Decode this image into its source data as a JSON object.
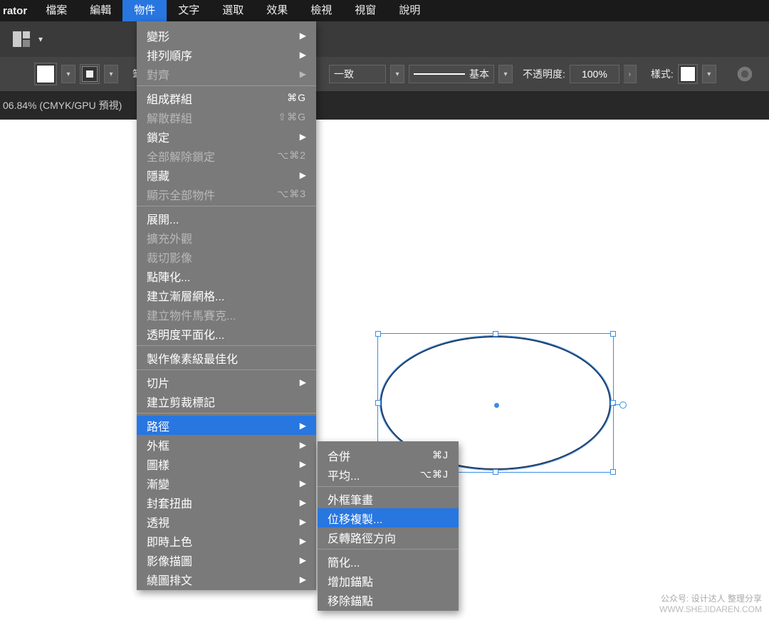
{
  "menubar": {
    "app": "rator",
    "items": [
      "檔案",
      "編輯",
      "物件",
      "文字",
      "選取",
      "效果",
      "檢視",
      "視窗",
      "說明"
    ],
    "active_index": 2
  },
  "options_bar": {
    "stroke_uniform": "一致",
    "stroke_style": "基本",
    "opacity_label": "不透明度:",
    "opacity_value": "100%",
    "style_label": "樣式:",
    "brush_hint": "筆"
  },
  "document": {
    "tab_label": "06.84% (CMYK/GPU 預視)"
  },
  "menu_object": {
    "groups": [
      [
        {
          "label": "變形",
          "arrow": true
        },
        {
          "label": "排列順序",
          "arrow": true
        },
        {
          "label": "對齊",
          "arrow": true,
          "disabled": true
        }
      ],
      [
        {
          "label": "組成群組",
          "shortcut": "⌘G"
        },
        {
          "label": "解散群組",
          "shortcut": "⇧⌘G",
          "disabled": true
        },
        {
          "label": "鎖定",
          "arrow": true
        },
        {
          "label": "全部解除鎖定",
          "shortcut": "⌥⌘2",
          "disabled": true
        },
        {
          "label": "隱藏",
          "arrow": true
        },
        {
          "label": "顯示全部物件",
          "shortcut": "⌥⌘3",
          "disabled": true
        }
      ],
      [
        {
          "label": "展開..."
        },
        {
          "label": "擴充外觀",
          "disabled": true
        },
        {
          "label": "裁切影像",
          "disabled": true
        },
        {
          "label": "點陣化..."
        },
        {
          "label": "建立漸層網格..."
        },
        {
          "label": "建立物件馬賽克...",
          "disabled": true
        },
        {
          "label": "透明度平面化..."
        }
      ],
      [
        {
          "label": "製作像素級最佳化"
        }
      ],
      [
        {
          "label": "切片",
          "arrow": true
        },
        {
          "label": "建立剪裁標記"
        }
      ],
      [
        {
          "label": "路徑",
          "arrow": true,
          "hl": true
        },
        {
          "label": "外框",
          "arrow": true
        },
        {
          "label": "圖樣",
          "arrow": true
        },
        {
          "label": "漸變",
          "arrow": true
        },
        {
          "label": "封套扭曲",
          "arrow": true
        },
        {
          "label": "透視",
          "arrow": true
        },
        {
          "label": "即時上色",
          "arrow": true
        },
        {
          "label": "影像描圖",
          "arrow": true
        },
        {
          "label": "繞圖排文",
          "arrow": true
        }
      ]
    ]
  },
  "submenu_path": {
    "groups": [
      [
        {
          "label": "合併",
          "shortcut": "⌘J"
        },
        {
          "label": "平均...",
          "shortcut": "⌥⌘J"
        }
      ],
      [
        {
          "label": "外框筆畫"
        },
        {
          "label": "位移複製...",
          "hl": true
        },
        {
          "label": "反轉路徑方向"
        }
      ],
      [
        {
          "label": "簡化..."
        },
        {
          "label": "增加錨點"
        },
        {
          "label": "移除錨點"
        }
      ]
    ]
  },
  "watermark": {
    "line1": "公众号: 设计达人 整理分享",
    "line2": "WWW.SHEJIDAREN.COM"
  }
}
